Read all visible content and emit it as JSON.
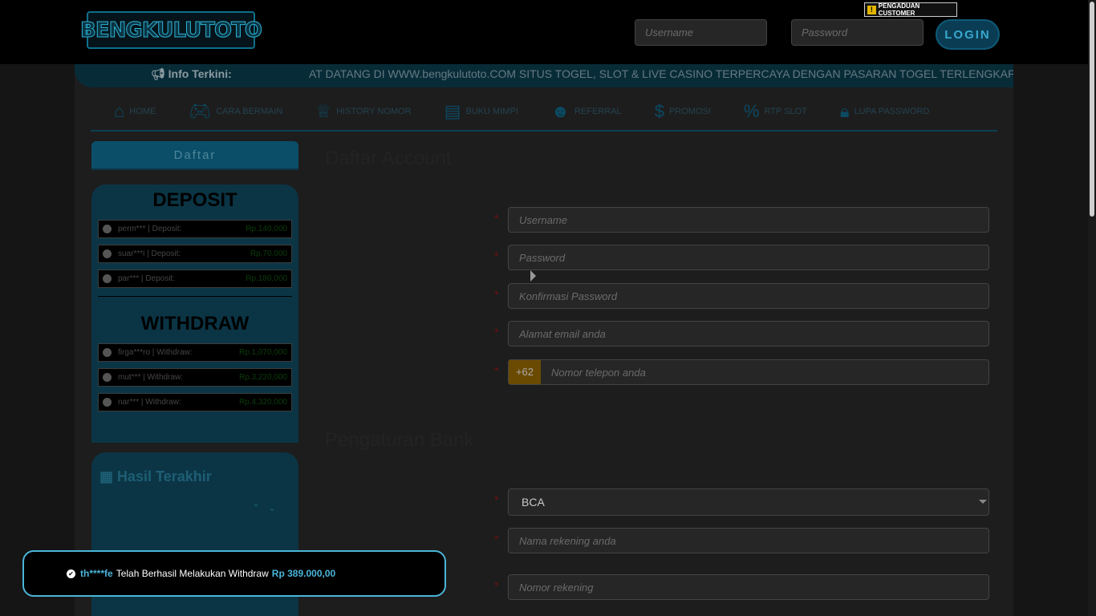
{
  "header": {
    "logo_text": "BENGKULUTOTO",
    "username_placeholder": "Username",
    "password_placeholder": "Password",
    "login_label": "LOGIN",
    "complaint_label": "PENGADUAN CUSTOMER"
  },
  "ticker": {
    "label": "Info Terkini:",
    "text": "AT DATANG DI WWW.bengkulutoto.COM SITUS TOGEL, SLOT & LIVE CASINO TERPERCAYA DENGAN PASARAN TOGEL TERLENGKAP"
  },
  "nav": {
    "items": [
      {
        "label": "HOME",
        "icon": "home-icon"
      },
      {
        "label": "CARA BERMAIN",
        "icon": "gamepad-icon"
      },
      {
        "label": "HISTORY NOMOR",
        "icon": "trophy-icon"
      },
      {
        "label": "BUKU MIMPI",
        "icon": "book-icon"
      },
      {
        "label": "REFERRAL",
        "icon": "users-icon"
      },
      {
        "label": "PROMOSI",
        "icon": "dollar-icon"
      },
      {
        "label": "RTP SLOT",
        "icon": "percent-icon"
      },
      {
        "label": "LUPA PASSWORD",
        "icon": "lock-icon"
      }
    ]
  },
  "sidebar": {
    "daftar_label": "Daftar",
    "deposit_title": "DEPOSIT",
    "deposits": [
      {
        "text": "perm*** | Deposit:",
        "amount": "Rp.140,000"
      },
      {
        "text": "suar***i | Deposit:",
        "amount": "Rp.70,000"
      },
      {
        "text": "par*** | Deposit:",
        "amount": "Rp.180,000"
      }
    ],
    "withdraw_title": "WITHDRAW",
    "withdraws": [
      {
        "text": "firga***ro | Withdraw:",
        "amount": "Rp.1,070,000"
      },
      {
        "text": "mut*** | Withdraw:",
        "amount": "Rp.3,220,000"
      },
      {
        "text": "nar*** | Withdraw:",
        "amount": "Rp.4,320,000"
      }
    ],
    "hasil_title": "Hasil Terakhir"
  },
  "form": {
    "title": "Daftar Account",
    "username_placeholder": "Username",
    "password_placeholder": "Password",
    "confirm_placeholder": "Konfirmasi Password",
    "email_placeholder": "Alamat email anda",
    "phone_prefix": "+62",
    "phone_placeholder": "Nomor telepon anda",
    "bank_title": "Pengaturan Bank",
    "bank_selected": "BCA",
    "account_name_placeholder": "Nama rekening anda",
    "account_number_placeholder": "Nomor rekening"
  },
  "toast": {
    "user": "th****fe",
    "message": "Telah Berhasil Melakukan Withdraw",
    "amount": "Rp 389.000,00"
  },
  "colors": {
    "accent": "#4ab5d9",
    "panel": "#0b3545"
  }
}
